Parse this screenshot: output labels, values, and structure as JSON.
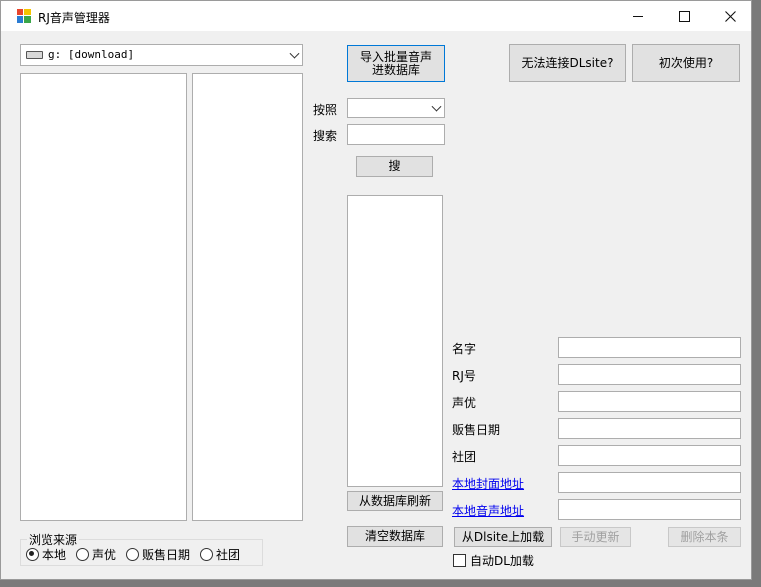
{
  "window": {
    "title": "RJ音声管理器"
  },
  "drive": {
    "label": "g: [download]"
  },
  "buttons": {
    "import": "导入批量音声进数据库",
    "cannot_connect": "无法连接DLsite?",
    "first_use": "初次使用?",
    "search": "搜",
    "refresh_from_db": "从数据库刷新",
    "clear_db": "清空数据库",
    "load_from_dlsite": "从Dlsite上加载",
    "manual_update": "手动更新",
    "delete_entry": "删除本条"
  },
  "search": {
    "sort_label": "按照",
    "search_label": "搜索",
    "sort_value": "",
    "query": ""
  },
  "details": {
    "name": "名字",
    "rj": "RJ号",
    "cv": "声优",
    "date": "贩售日期",
    "circle": "社团",
    "cover_link": "本地封面地址",
    "audio_link": "本地音声地址"
  },
  "auto_dl": "自动DL加载",
  "browse": {
    "legend": "浏览来源",
    "options": [
      "本地",
      "声优",
      "贩售日期",
      "社团"
    ],
    "selected": "本地"
  }
}
